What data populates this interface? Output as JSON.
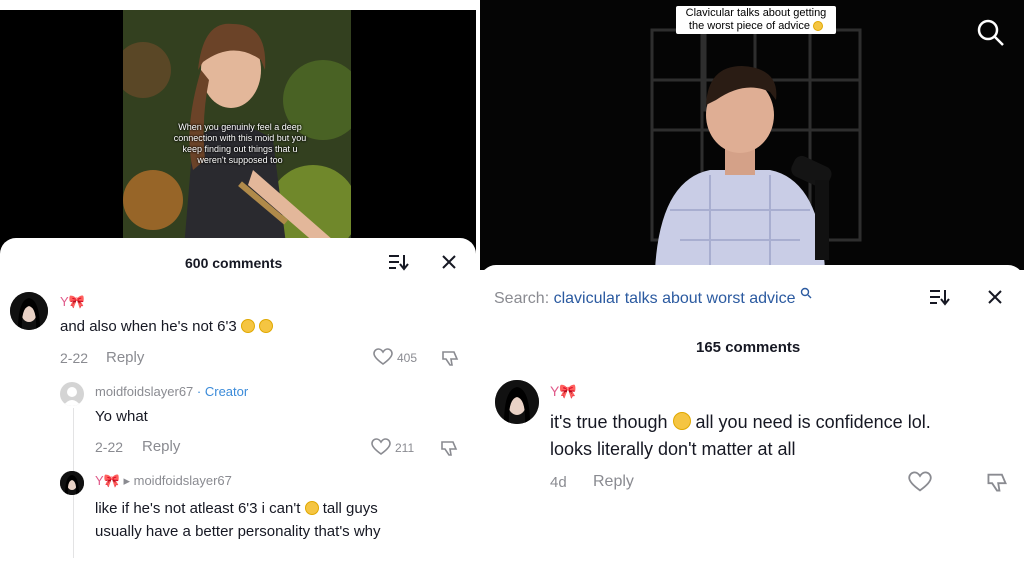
{
  "left": {
    "video_caption": "When you genuinly feel a deep connection with this moid but you keep finding out things that u weren't supposed too",
    "comments_title": "600 comments",
    "comments": [
      {
        "username": "Y🎀",
        "text": "and also when he's not 6'3",
        "date": "2-22",
        "reply": "Reply",
        "likes": "405"
      },
      {
        "username": "moidfoidslayer67",
        "creator_tag": "· Creator",
        "text": "Yo what",
        "date": "2-22",
        "reply": "Reply",
        "likes": "211"
      },
      {
        "username": "Y🎀",
        "reply_to": "▸ moidfoidslayer67",
        "text_part1": "like if he's not atleast 6'3 i can't",
        "text_part2": "tall guys",
        "text_line2": "usually have a better personality that's why"
      }
    ]
  },
  "right": {
    "video_caption": "Clavicular talks about getting the worst piece of advice",
    "search_prefix": "Search:",
    "search_query": "clavicular talks about worst advice",
    "comments_title": "165 comments",
    "comment": {
      "username": "Y🎀",
      "text_part1": "it's true though",
      "text_part2": "all you need is confidence lol.",
      "text_line2": "looks literally don't matter at all",
      "date": "4d",
      "reply": "Reply"
    }
  },
  "colors": {
    "text_primary": "#161823",
    "text_secondary": "#8a8b91",
    "creator_blue": "#3b8bd9",
    "search_blue": "#2b5aa0"
  },
  "icons": [
    "sort-icon",
    "close-icon",
    "heart-icon",
    "dislike-icon",
    "search-icon"
  ]
}
